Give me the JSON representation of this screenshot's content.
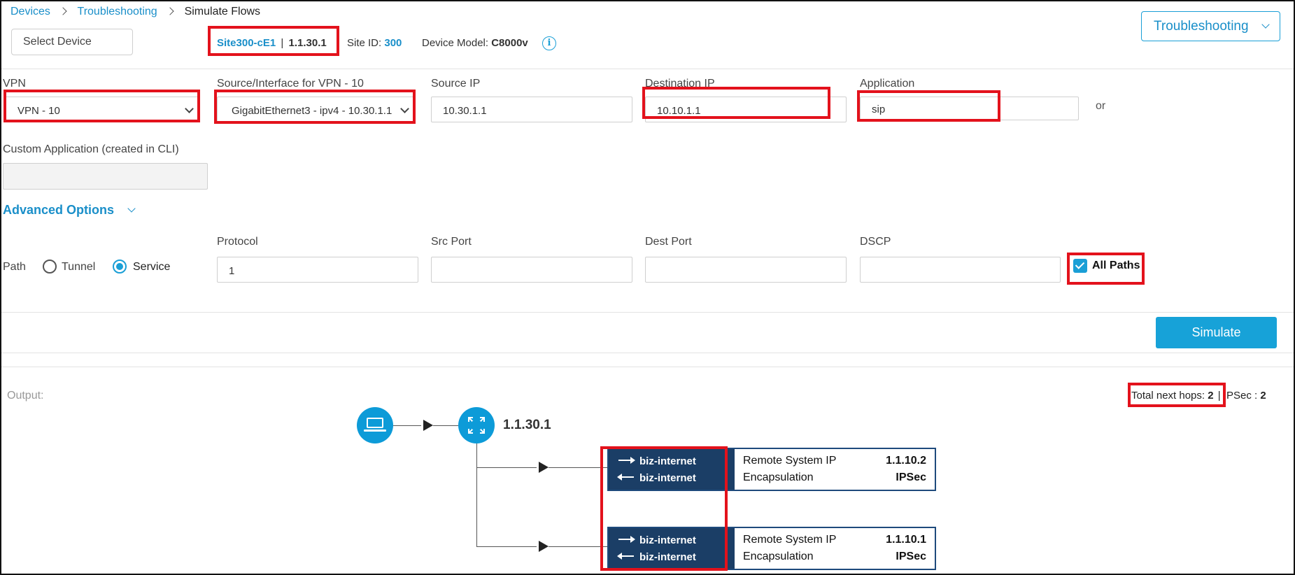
{
  "breadcrumb": {
    "item1": "Devices",
    "item2": "Troubleshooting",
    "current": "Simulate Flows"
  },
  "header": {
    "select_device_placeholder": "Select Device",
    "site_name": "Site300-cE1",
    "site_sep": "|",
    "system_ip": "1.1.30.1",
    "site_id_label": "Site ID:",
    "site_id_value": "300",
    "device_model_label": "Device Model:",
    "device_model_value": "C8000v",
    "troubleshooting_button": "Troubleshooting"
  },
  "form": {
    "vpn_label": "VPN",
    "vpn_value": "VPN - 10",
    "source_label": "Source/Interface for VPN - 10",
    "source_value": "GigabitEthernet3 - ipv4 - 10.30.1.1",
    "source_ip_label": "Source IP",
    "source_ip_value": "10.30.1.1",
    "dest_ip_label": "Destination IP",
    "dest_ip_value": "10.10.1.1",
    "application_label": "Application",
    "application_value": "sip",
    "or_text": "or",
    "custom_app_label": "Custom Application (created in CLI)",
    "advanced_options": "Advanced Options",
    "path_label": "Path",
    "path_options": [
      "Tunnel",
      "Service"
    ],
    "path_selected": "Service",
    "protocol_label": "Protocol",
    "protocol_value": "1",
    "src_port_label": "Src Port",
    "dest_port_label": "Dest Port",
    "dscp_label": "DSCP",
    "all_paths_label": "All Paths",
    "simulate_button": "Simulate"
  },
  "output": {
    "label": "Output:",
    "total_hops_label": "Total next hops:",
    "total_hops_value": "2",
    "ipsec_label": "| IPSec :",
    "ipsec_value": "2",
    "router_ip": "1.1.30.1",
    "hops": [
      {
        "out_color": "biz-internet",
        "in_color": "biz-internet",
        "remote_ip_label": "Remote System IP",
        "remote_ip": "1.1.10.2",
        "encap_label": "Encapsulation",
        "encap": "IPSec"
      },
      {
        "out_color": "biz-internet",
        "in_color": "biz-internet",
        "remote_ip_label": "Remote System IP",
        "remote_ip": "1.1.10.1",
        "encap_label": "Encapsulation",
        "encap": "IPSec"
      }
    ]
  },
  "icons": [
    "chevron-right-icon",
    "chevron-down-icon",
    "info-icon",
    "laptop-icon",
    "router-icon",
    "arrow-right-icon",
    "arrow-left-icon"
  ],
  "colors": {
    "accent": "#17a2d8",
    "link": "#1a8fc9",
    "highlight": "#e3121c",
    "hop_dark": "#1b3e66"
  }
}
